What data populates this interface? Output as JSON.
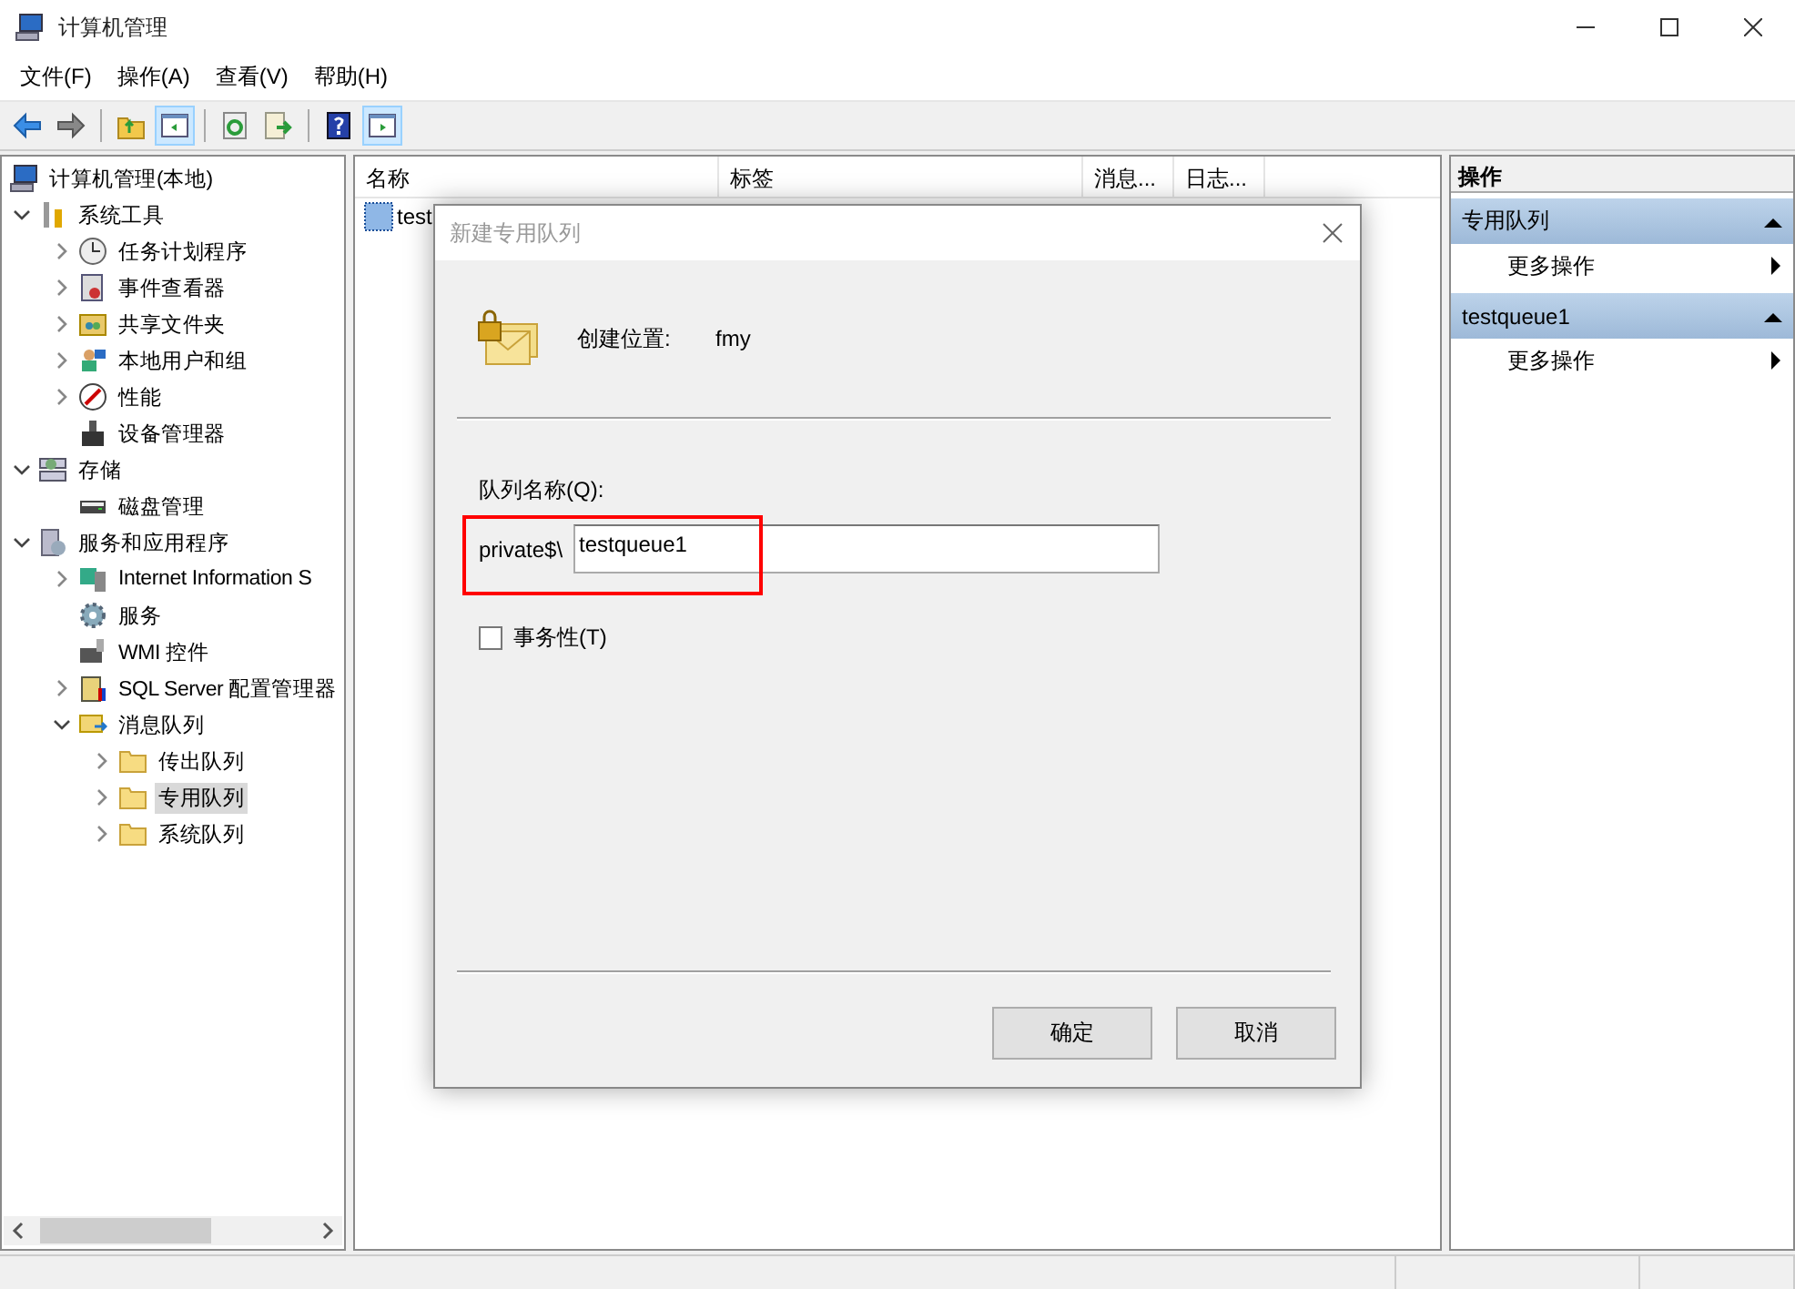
{
  "window": {
    "title": "计算机管理"
  },
  "menu": [
    "文件(F)",
    "操作(A)",
    "查看(V)",
    "帮助(H)"
  ],
  "toolbar": [
    {
      "kind": "back",
      "pressed": false
    },
    {
      "kind": "forward",
      "pressed": false
    },
    {
      "kind": "sep"
    },
    {
      "kind": "up",
      "pressed": false
    },
    {
      "kind": "tree",
      "pressed": true
    },
    {
      "kind": "sep"
    },
    {
      "kind": "refresh",
      "pressed": false
    },
    {
      "kind": "export",
      "pressed": false
    },
    {
      "kind": "sep"
    },
    {
      "kind": "help",
      "pressed": false
    },
    {
      "kind": "actions",
      "pressed": true
    }
  ],
  "tree": [
    {
      "label": "计算机管理(本地)",
      "kind": "computer",
      "selected": false,
      "children": [
        {
          "label": "系统工具",
          "kind": "tools",
          "expanded": true,
          "selected": false,
          "children": [
            {
              "label": "任务计划程序",
              "kind": "clock",
              "expanded": false,
              "selected": false
            },
            {
              "label": "事件查看器",
              "kind": "event",
              "expanded": false,
              "selected": false
            },
            {
              "label": "共享文件夹",
              "kind": "share",
              "expanded": false,
              "selected": false
            },
            {
              "label": "本地用户和组",
              "kind": "users",
              "expanded": false,
              "selected": false
            },
            {
              "label": "性能",
              "kind": "perf",
              "expanded": false,
              "selected": false
            },
            {
              "label": "设备管理器",
              "kind": "device",
              "selected": false
            }
          ]
        },
        {
          "label": "存储",
          "kind": "storage",
          "expanded": true,
          "selected": false,
          "children": [
            {
              "label": "磁盘管理",
              "kind": "disk",
              "selected": false
            }
          ]
        },
        {
          "label": "服务和应用程序",
          "kind": "apps",
          "expanded": true,
          "selected": false,
          "children": [
            {
              "label": "Internet Information S",
              "kind": "iis",
              "expanded": false,
              "selected": false
            },
            {
              "label": "服务",
              "kind": "gear",
              "selected": false
            },
            {
              "label": "WMI 控件",
              "kind": "wmi",
              "selected": false
            },
            {
              "label": "SQL Server 配置管理器",
              "kind": "sql",
              "expanded": false,
              "selected": false
            },
            {
              "label": "消息队列",
              "kind": "mq",
              "expanded": true,
              "selected": false,
              "children": [
                {
                  "label": "传出队列",
                  "kind": "folder",
                  "expanded": false,
                  "selected": false
                },
                {
                  "label": "专用队列",
                  "kind": "folder",
                  "expanded": false,
                  "selected": true
                },
                {
                  "label": "系统队列",
                  "kind": "folder",
                  "expanded": false,
                  "selected": false
                }
              ]
            }
          ]
        }
      ]
    }
  ],
  "list": {
    "columns": [
      "名称",
      "标签",
      "消息...",
      "日志..."
    ],
    "rows": [
      {
        "name": "test"
      }
    ]
  },
  "actions": [
    {
      "title": "操作",
      "groups": [
        {
          "title": "专用队列",
          "expanded": true,
          "items": [
            "更多操作"
          ]
        },
        {
          "title": "testqueue1",
          "expanded": true,
          "items": [
            "更多操作"
          ]
        }
      ]
    }
  ],
  "dialog": {
    "title": "新建专用队列",
    "location_label": "创建位置:",
    "location": "fmy",
    "name_label": "队列名称(Q):",
    "prefix": "private$\\",
    "name_value": "testqueue1",
    "transactional": {
      "label": "事务性(T)",
      "checked": false
    },
    "buttons": [
      "确定",
      "取消"
    ]
  }
}
